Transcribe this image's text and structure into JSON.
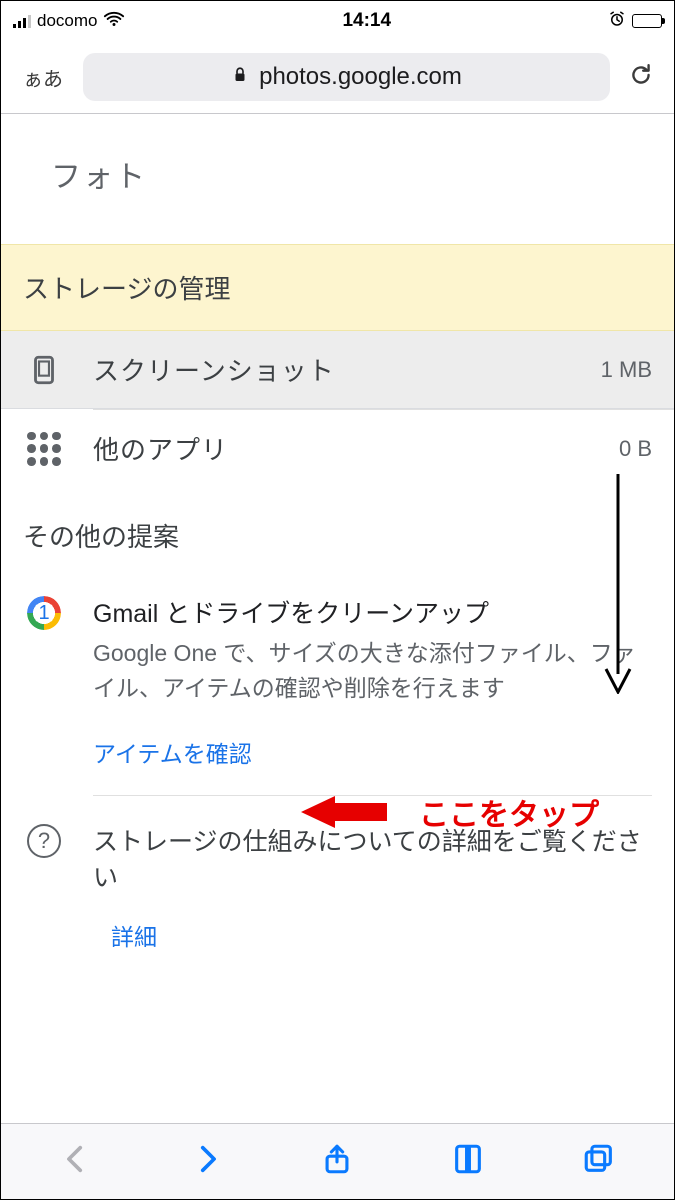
{
  "status": {
    "carrier": "docomo",
    "time": "14:14"
  },
  "safari": {
    "aa_label": "ぁあ",
    "url": "photos.google.com"
  },
  "photos_header": {
    "title": "フォト"
  },
  "banner": {
    "label": "ストレージの管理"
  },
  "rows": {
    "screenshots": {
      "label": "スクリーンショット",
      "size": "1 MB"
    },
    "other_apps": {
      "label": "他のアプリ",
      "size": "0 B"
    }
  },
  "suggest": {
    "section_title": "その他の提案",
    "cleanup": {
      "badge_num": "1",
      "title": "Gmail とドライブをクリーンアップ",
      "desc": "Google One で、サイズの大きな添付ファイル、ファイル、アイテムの確認や削除を行えます",
      "action": "アイテムを確認"
    },
    "help": {
      "title": "ストレージの仕組みについての詳細をご覧ください",
      "action": "詳細"
    }
  },
  "annotation": {
    "tap_here": "ここをタップ"
  }
}
